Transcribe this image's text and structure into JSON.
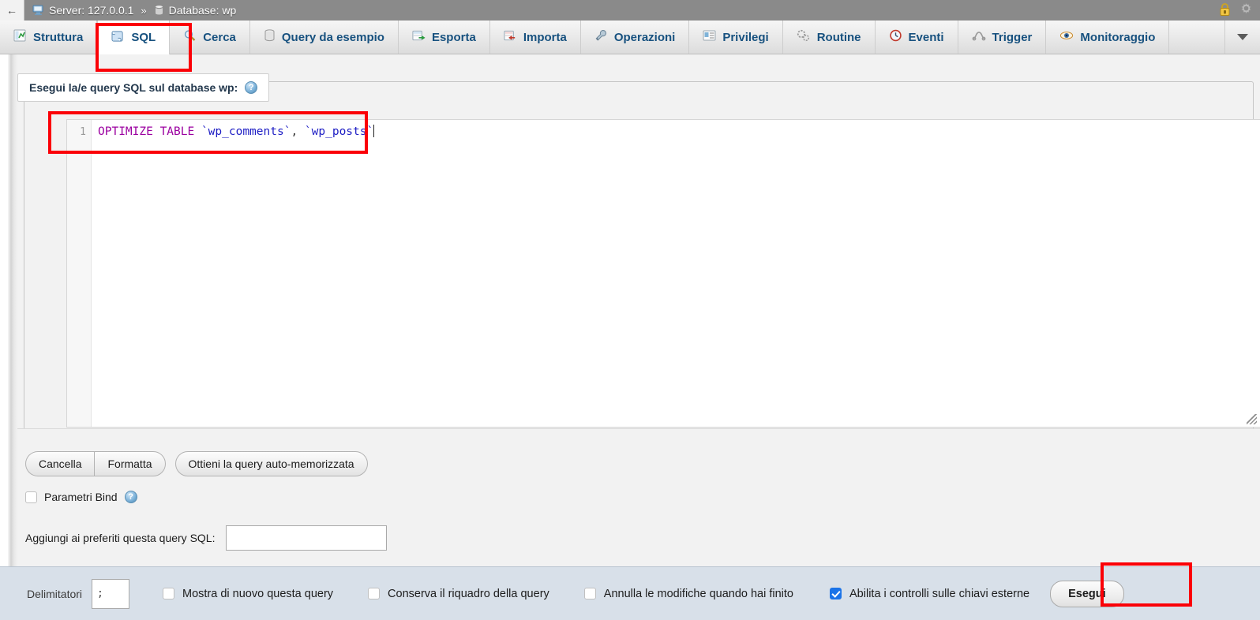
{
  "breadcrumb": {
    "back_icon": "back-arrow-icon",
    "server_icon": "server-monitor-icon",
    "server_label": "Server: 127.0.0.1",
    "separator": "»",
    "database_icon": "database-icon",
    "database_label": "Database: wp",
    "lock_icon": "padlock-icon",
    "settings_icon": "gear-icon"
  },
  "tabs": [
    {
      "label": "Struttura",
      "icon": "structure-icon",
      "active": false
    },
    {
      "label": "SQL",
      "icon": "sql-scroll-icon",
      "active": true
    },
    {
      "label": "Cerca",
      "icon": "magnifier-icon",
      "active": false
    },
    {
      "label": "Query da esempio",
      "icon": "query-box-icon",
      "active": false
    },
    {
      "label": "Esporta",
      "icon": "export-icon",
      "active": false
    },
    {
      "label": "Importa",
      "icon": "import-icon",
      "active": false
    },
    {
      "label": "Operazioni",
      "icon": "wrench-icon",
      "active": false
    },
    {
      "label": "Privilegi",
      "icon": "privileges-icon",
      "active": false
    },
    {
      "label": "Routine",
      "icon": "gears-icon",
      "active": false
    },
    {
      "label": "Eventi",
      "icon": "clock-icon",
      "active": false
    },
    {
      "label": "Trigger",
      "icon": "trigger-icon",
      "active": false
    },
    {
      "label": "Monitoraggio",
      "icon": "eye-icon",
      "active": false
    }
  ],
  "tab_overflow_icon": "chevron-down-icon",
  "query_panel": {
    "legend": "Esegui la/e query SQL sul database wp:",
    "legend_help_icon": "help-icon",
    "legend_help_glyph": "?",
    "editor": {
      "line_number": "1",
      "tokens": [
        {
          "text": "OPTIMIZE TABLE ",
          "type": "keyword"
        },
        {
          "text": "`wp_comments`",
          "type": "identifier"
        },
        {
          "text": ", ",
          "type": "punctuation"
        },
        {
          "text": "`wp_posts`",
          "type": "identifier"
        }
      ],
      "full_text": "OPTIMIZE TABLE `wp_comments`, `wp_posts`",
      "resize_handle_icon": "resize-grip-icon"
    },
    "buttons": {
      "clear": "Cancella",
      "format": "Formatta",
      "get_autosaved": "Ottieni la query auto-memorizzata"
    },
    "bind_params": {
      "label": "Parametri Bind",
      "checked": false,
      "help_icon": "help-icon",
      "help_glyph": "?"
    },
    "bookmark": {
      "label": "Aggiungi ai preferiti questa query SQL:",
      "value": "",
      "placeholder": ""
    }
  },
  "bottom_bar": {
    "delimiter_label": "Delimitatori",
    "delimiter_value": ";",
    "options": [
      {
        "label": "Mostra di nuovo questa query",
        "checked": false
      },
      {
        "label": "Conserva il riquadro della query",
        "checked": false
      },
      {
        "label": "Annulla le modifiche quando hai finito",
        "checked": false
      },
      {
        "label": "Abilita i controlli sulle chiavi esterne",
        "checked": true
      }
    ],
    "execute_button": "Esegui"
  },
  "annotations": [
    {
      "name": "sql-tab-highlight",
      "color": "#fb0007"
    },
    {
      "name": "query-text-highlight",
      "color": "#fb0007"
    },
    {
      "name": "execute-highlight",
      "color": "#fb0007"
    }
  ],
  "colors": {
    "breadcrumb_bg": "#8a8a8a",
    "tab_text": "#17517f",
    "bottom_bar_bg": "#d8e0e9",
    "checked_checkbox": "#1a73e8",
    "sql_keyword": "#9b00a0",
    "sql_identifier": "#1d1dc4",
    "annotation": "#fb0007"
  }
}
